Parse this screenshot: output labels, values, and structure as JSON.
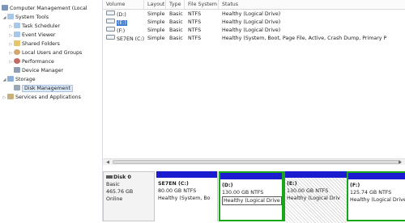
{
  "tree": {
    "root": "Computer Management (Local",
    "items": [
      {
        "label": "System Tools"
      },
      {
        "label": "Task Scheduler"
      },
      {
        "label": "Event Viewer"
      },
      {
        "label": "Shared Folders"
      },
      {
        "label": "Local Users and Groups"
      },
      {
        "label": "Performance"
      },
      {
        "label": "Device Manager"
      },
      {
        "label": "Storage"
      },
      {
        "label": "Disk Management"
      },
      {
        "label": "Services and Applications"
      }
    ]
  },
  "list": {
    "columns": [
      "Volume",
      "Layout",
      "Type",
      "File System",
      "Status"
    ],
    "rows": [
      {
        "volume": "(D:)",
        "layout": "Simple",
        "type": "Basic",
        "fs": "NTFS",
        "status": "Healthy (Logical Drive)"
      },
      {
        "volume": "(E:)",
        "layout": "Simple",
        "type": "Basic",
        "fs": "NTFS",
        "status": "Healthy (Logical Drive)"
      },
      {
        "volume": "(F:)",
        "layout": "Simple",
        "type": "Basic",
        "fs": "NTFS",
        "status": "Healthy (Logical Drive)"
      },
      {
        "volume": "SE7EN (C:)",
        "layout": "Simple",
        "type": "Basic",
        "fs": "NTFS",
        "status": "Healthy (System, Boot, Page File, Active, Crash Dump, Primary P"
      }
    ]
  },
  "disk": {
    "name": "Disk 0",
    "type": "Basic",
    "size": "465.76 GB",
    "state": "Online"
  },
  "partitions": [
    {
      "name": "SE7EN (C:)",
      "size": "80.00 GB NTFS",
      "status": "Healthy (System, Bo"
    },
    {
      "name": "(D:)",
      "size": "130.00 GB NTFS",
      "status": "Healthy (Logical Drive"
    },
    {
      "name": "(E:)",
      "size": "130.00 GB NTFS",
      "status": "Healthy (Logical Driv"
    },
    {
      "name": "(F:)",
      "size": "125.74 GB NTFS",
      "status": "Healthy (Logical Drive"
    }
  ],
  "colors": {
    "partition_bar": "#1b1bd0",
    "selected_border": "#1ba51b",
    "selection": "#3a7bd5"
  }
}
